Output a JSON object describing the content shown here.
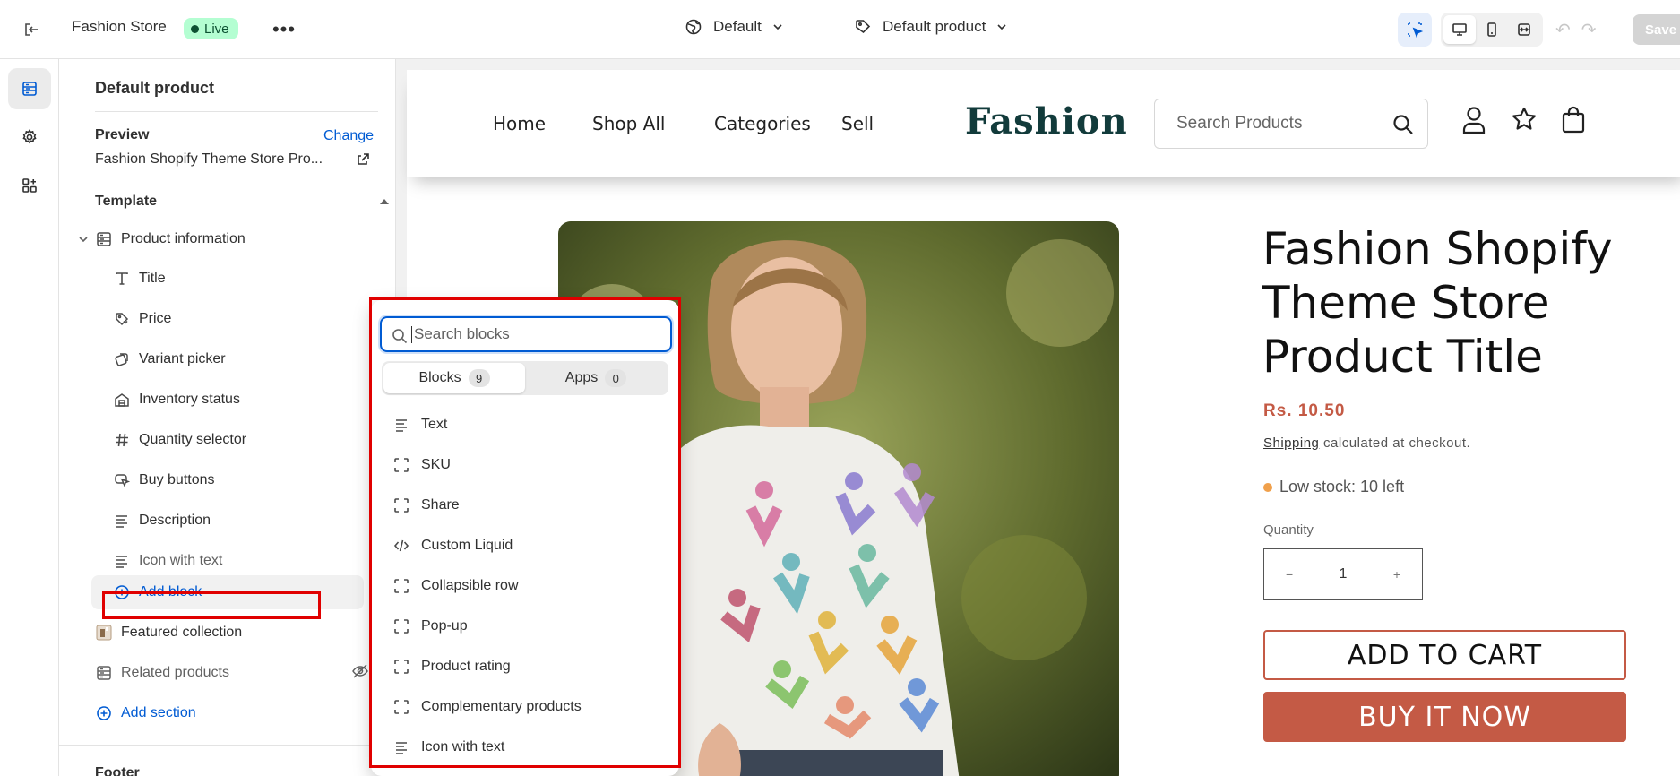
{
  "topbar": {
    "store_name": "Fashion Store",
    "status_badge": "Live",
    "theme_selector": "Default",
    "template_selector": "Default product",
    "save_label": "Save"
  },
  "sidebar": {
    "title": "Default product",
    "preview_label": "Preview",
    "change_link": "Change",
    "preview_value": "Fashion Shopify Theme Store Pro...",
    "template_heading": "Template",
    "section_product_information": "Product information",
    "blocks": [
      {
        "label": "Title",
        "icon": "text-icon"
      },
      {
        "label": "Price",
        "icon": "price-tag-icon"
      },
      {
        "label": "Variant picker",
        "icon": "variant-icon"
      },
      {
        "label": "Inventory status",
        "icon": "inventory-icon"
      },
      {
        "label": "Quantity selector",
        "icon": "hash-icon"
      },
      {
        "label": "Buy buttons",
        "icon": "cursor-icon"
      },
      {
        "label": "Description",
        "icon": "paragraph-icon"
      },
      {
        "label": "Icon with text",
        "icon": "paragraph-icon",
        "hidden": true
      }
    ],
    "add_block": "Add block",
    "featured_collection": "Featured collection",
    "related_products": "Related products",
    "add_section": "Add section",
    "footer_heading": "Footer"
  },
  "popover": {
    "search_placeholder": "Search blocks",
    "tabs": [
      {
        "label": "Blocks",
        "count": "9",
        "active": true
      },
      {
        "label": "Apps",
        "count": "0",
        "active": false
      }
    ],
    "items": [
      {
        "label": "Text",
        "icon": "paragraph-icon"
      },
      {
        "label": "SKU",
        "icon": "block-frame-icon"
      },
      {
        "label": "Share",
        "icon": "block-frame-icon"
      },
      {
        "label": "Custom Liquid",
        "icon": "code-icon"
      },
      {
        "label": "Collapsible row",
        "icon": "block-frame-icon"
      },
      {
        "label": "Pop-up",
        "icon": "block-frame-icon"
      },
      {
        "label": "Product rating",
        "icon": "block-frame-icon"
      },
      {
        "label": "Complementary products",
        "icon": "block-frame-icon"
      },
      {
        "label": "Icon with text",
        "icon": "paragraph-icon"
      }
    ]
  },
  "storefront": {
    "nav": [
      "Home",
      "Shop All",
      "Categories",
      "Sell"
    ],
    "logo": "Fashion",
    "search_placeholder": "Search Products",
    "product_title": "Fashion Shopify Theme Store Product Title",
    "price": "Rs. 10.50",
    "shipping_link": "Shipping",
    "shipping_rest": " calculated at checkout.",
    "stock": "Low stock: 10 left",
    "quantity_label": "Quantity",
    "quantity_value": "1",
    "minus": "−",
    "plus": "+",
    "add_to_cart": "ADD TO CART",
    "buy_now": "BUY IT NOW"
  },
  "colors": {
    "accent": "#005bd3",
    "brand_terracotta": "#c45a45",
    "logo_teal": "#123b3b",
    "highlight_red": "#e00000",
    "live_badge": "#b4fed2"
  }
}
